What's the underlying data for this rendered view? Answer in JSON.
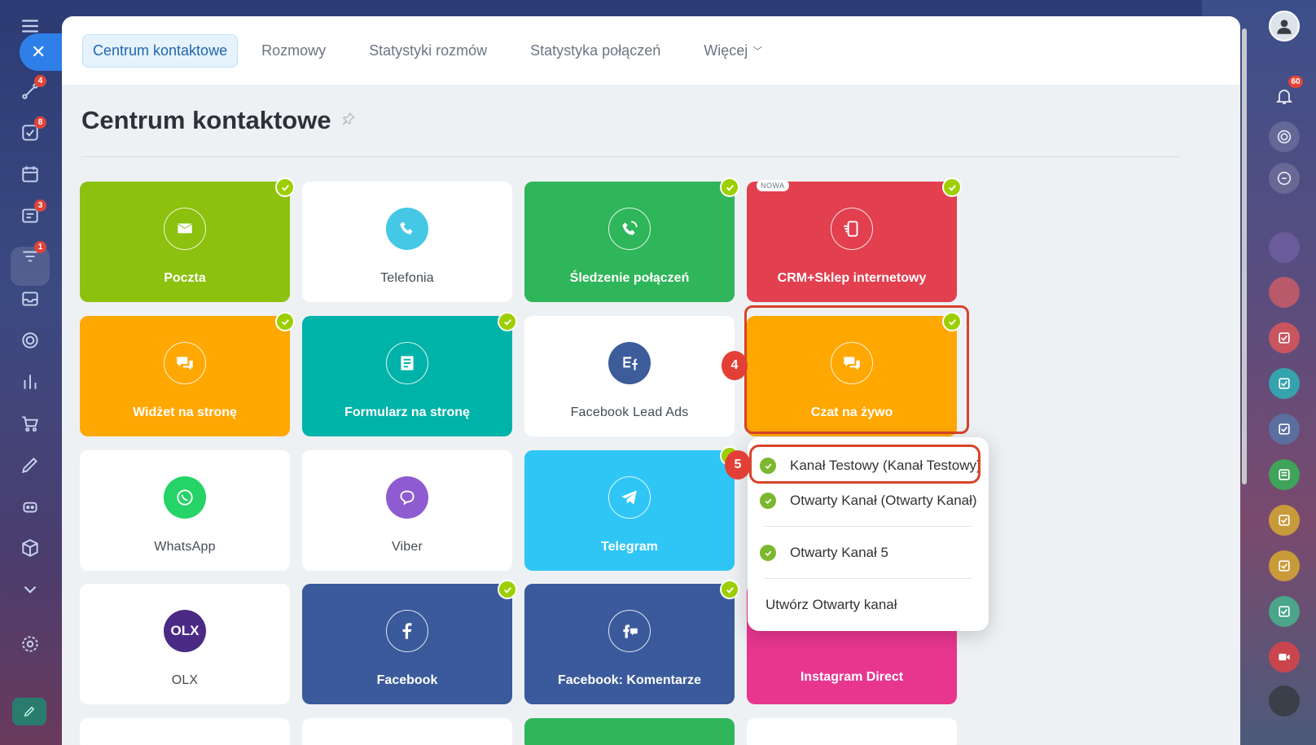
{
  "top_nav": {
    "tabs": [
      {
        "label": "Centrum kontaktowe",
        "active": true
      },
      {
        "label": "Rozmowy"
      },
      {
        "label": "Statystyki rozmów"
      },
      {
        "label": "Statystyka połączeń"
      },
      {
        "label": "Więcej"
      }
    ]
  },
  "page": {
    "title": "Centrum kontaktowe"
  },
  "tiles": [
    {
      "label": "Poczta",
      "icon": "envelope-icon",
      "color": "#8cc10d",
      "connected": true
    },
    {
      "label": "Telefonia",
      "icon": "phone-icon",
      "color": "#ffffff",
      "connected": false
    },
    {
      "label": "Śledzenie połączeń",
      "icon": "call-tracking-icon",
      "color": "#2fb55a",
      "connected": true
    },
    {
      "label": "CRM+Sklep internetowy",
      "icon": "shop-icon",
      "color": "#e23f4f",
      "connected": true,
      "badge": "NOWA"
    },
    {
      "label": "Widżet na stronę",
      "icon": "chat-bubbles-icon",
      "color": "#ffa702",
      "connected": true
    },
    {
      "label": "Formularz na stronę",
      "icon": "form-icon",
      "color": "#00b3a8",
      "connected": true
    },
    {
      "label": "Facebook Lead Ads",
      "icon": "facebook-lead-ads-icon",
      "color": "#ffffff",
      "connected": false
    },
    {
      "label": "Czat na żywo",
      "icon": "chat-bubbles-icon",
      "color": "#ffa702",
      "connected": true
    },
    {
      "label": "WhatsApp",
      "icon": "whatsapp-icon",
      "color": "#ffffff",
      "connected": false
    },
    {
      "label": "Viber",
      "icon": "viber-icon",
      "color": "#ffffff",
      "connected": false
    },
    {
      "label": "Telegram",
      "icon": "telegram-icon",
      "color": "#2fc6f6",
      "connected": true
    },
    {
      "label": "OLX",
      "icon": "olx-icon",
      "color": "#ffffff",
      "connected": false
    },
    {
      "label": "Facebook",
      "icon": "facebook-icon",
      "color": "#3a5a9b",
      "connected": true
    },
    {
      "label": "Facebook: Komentarze",
      "icon": "facebook-comments-icon",
      "color": "#3a5a9b",
      "connected": true
    },
    {
      "label": "Instagram Direct",
      "icon": "instagram-icon",
      "color": "#e8368f",
      "connected": false
    }
  ],
  "steps": {
    "four": "4",
    "five": "5"
  },
  "dropdown": {
    "items": [
      {
        "label": "Kanał Testowy (Kanał Testowy)",
        "active": true
      },
      {
        "label": "Otwarty Kanał (Otwarty Kanał)",
        "active": true
      },
      {
        "label": "Otwarty Kanał 5",
        "active": true
      }
    ],
    "create_label": "Utwórz Otwarty kanał"
  },
  "left_sidebar": {
    "badges": {
      "feed": "4",
      "tasks": "8",
      "messages": "3",
      "crm": "1"
    }
  },
  "right_sidebar": {
    "notifications_badge": "60"
  },
  "colors": {
    "accent": "#2067b0",
    "check": "#9dcf00",
    "highlight": "#d9432a"
  }
}
